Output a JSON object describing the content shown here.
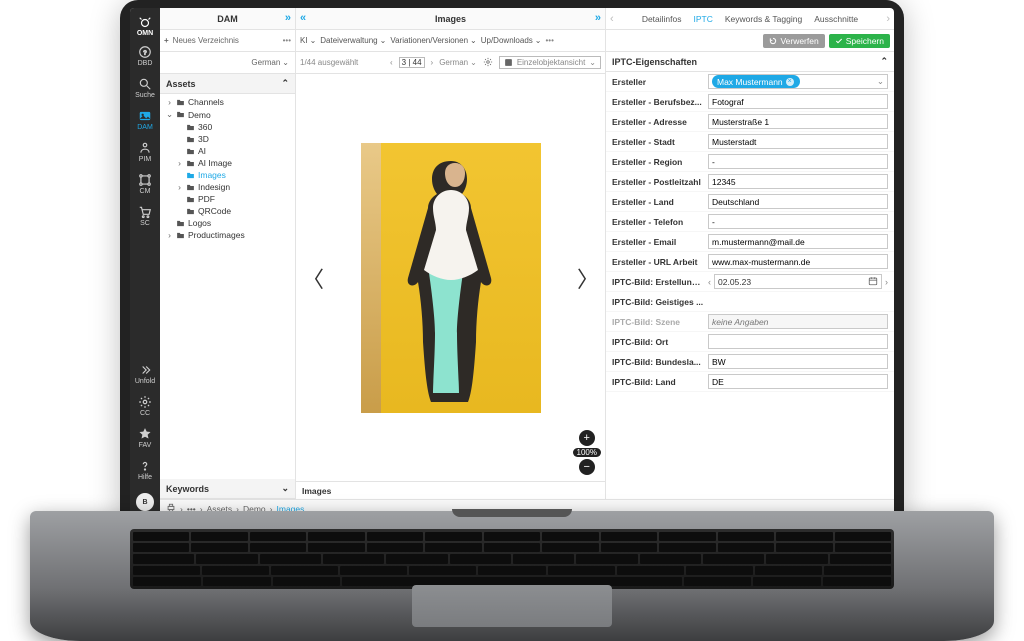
{
  "brand": "OMN",
  "rail": [
    {
      "id": "dbd",
      "label": "DBD"
    },
    {
      "id": "suche",
      "label": "Suche"
    },
    {
      "id": "dam",
      "label": "DAM"
    },
    {
      "id": "pim",
      "label": "PIM"
    },
    {
      "id": "cm",
      "label": "CM"
    },
    {
      "id": "sc",
      "label": "SC"
    }
  ],
  "rail_bottom": [
    {
      "id": "unfold",
      "label": "Unfold"
    },
    {
      "id": "cc",
      "label": "CC"
    },
    {
      "id": "fav",
      "label": "FAV"
    },
    {
      "id": "hilfe",
      "label": "Hilfe"
    }
  ],
  "rail_avatar": "B",
  "left": {
    "title": "DAM",
    "new_dir": "Neues Verzeichnis",
    "language": "German",
    "assets_title": "Assets",
    "keywords_title": "Keywords",
    "tree": [
      {
        "label": "Channels",
        "depth": 1,
        "caret": ">",
        "folder": true
      },
      {
        "label": "Demo",
        "depth": 1,
        "caret": "v",
        "folder": true
      },
      {
        "label": "360",
        "depth": 2,
        "caret": "",
        "folder": true
      },
      {
        "label": "3D",
        "depth": 2,
        "caret": "",
        "folder": true
      },
      {
        "label": "AI",
        "depth": 2,
        "caret": "",
        "folder": true
      },
      {
        "label": "AI Image",
        "depth": 2,
        "caret": ">",
        "folder": true
      },
      {
        "label": "Images",
        "depth": 2,
        "caret": "",
        "folder": true,
        "selected": true
      },
      {
        "label": "Indesign",
        "depth": 2,
        "caret": ">",
        "folder": true
      },
      {
        "label": "PDF",
        "depth": 2,
        "caret": "",
        "folder": true
      },
      {
        "label": "QRCode",
        "depth": 2,
        "caret": "",
        "folder": true
      },
      {
        "label": "Logos",
        "depth": 1,
        "caret": "",
        "folder": true
      },
      {
        "label": "Productimages",
        "depth": 1,
        "caret": ">",
        "folder": true
      }
    ]
  },
  "mid": {
    "title": "Images",
    "tools": [
      "KI",
      "Dateiverwaltung",
      "Variationen/Versionen",
      "Up/Downloads"
    ],
    "sel_count": "1/44 ausgewählt",
    "page": "3 | 44",
    "lang": "German",
    "view": "Einzelobjektansicht",
    "zoom": "100%",
    "footer": "Images"
  },
  "right": {
    "tabs": [
      "Detailinfos",
      "IPTC",
      "Keywords & Tagging",
      "Ausschnitte"
    ],
    "active_tab": 1,
    "discard": "Verwerfen",
    "save": "Speichern",
    "section_title": "IPTC-Eigenschaften",
    "creator_chip": "Max Mustermann",
    "scene_placeholder": "keine Angaben",
    "rows": [
      {
        "label": "Ersteller",
        "type": "chip"
      },
      {
        "label": "Ersteller - Berufsbez...",
        "value": "Fotograf"
      },
      {
        "label": "Ersteller - Adresse",
        "value": "Musterstraße 1"
      },
      {
        "label": "Ersteller - Stadt",
        "value": "Musterstadt"
      },
      {
        "label": "Ersteller - Region",
        "value": "-"
      },
      {
        "label": "Ersteller - Postleitzahl",
        "value": "12345"
      },
      {
        "label": "Ersteller - Land",
        "value": "Deutschland"
      },
      {
        "label": "Ersteller - Telefon",
        "value": "-"
      },
      {
        "label": "Ersteller - Email",
        "value": "m.mustermann@mail.de"
      },
      {
        "label": "Ersteller - URL Arbeit",
        "value": "www.max-mustermann.de"
      },
      {
        "label": "IPTC-Bild: Erstellung...",
        "type": "date",
        "value": "02.05.23"
      },
      {
        "label": "IPTC-Bild: Geistiges ...",
        "type": "blank"
      },
      {
        "label": "IPTC-Bild: Szene",
        "type": "disabled"
      },
      {
        "label": "IPTC-Bild: Ort",
        "value": ""
      },
      {
        "label": "IPTC-Bild: Bundesla...",
        "value": "BW"
      },
      {
        "label": "IPTC-Bild: Land",
        "value": "DE"
      }
    ]
  },
  "breadcrumb": [
    "Assets",
    "Demo",
    "Images"
  ]
}
